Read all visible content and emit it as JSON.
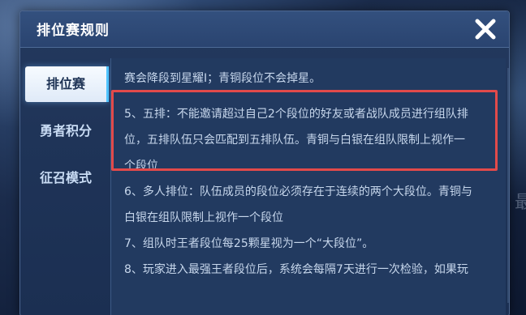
{
  "dialog": {
    "title": "排位赛规则",
    "close_icon": "close-icon"
  },
  "nav": {
    "tabs": [
      {
        "label": "排位赛",
        "active": true
      },
      {
        "label": "勇者积分",
        "active": false
      },
      {
        "label": "征召模式",
        "active": false
      }
    ]
  },
  "rules": {
    "lines": [
      "赛会降段到星耀I；青铜段位不会掉星。",
      "5、五排：不能邀请超过自己2个段位的好友或者战队成员进行组队排",
      "位，五排队伍只会匹配到五排队伍。青铜与白银在组队限制上视作一",
      "个段位",
      "6、多人排位：队伍成员的段位必须存在于连续的两个大段位。青铜与",
      "白银在组队限制上视作一个段位",
      "7、组队时王者段位每25颗星视为一个“大段位”。",
      "8、玩家进入最强王者段位后，系统会每隔7天进行一次检验，如果玩"
    ]
  },
  "background": {
    "partial_text": "最"
  },
  "colors": {
    "highlight": "#e24a4a",
    "active_tab_bg": "#f7fbff",
    "panel_bg": "#223a60"
  }
}
